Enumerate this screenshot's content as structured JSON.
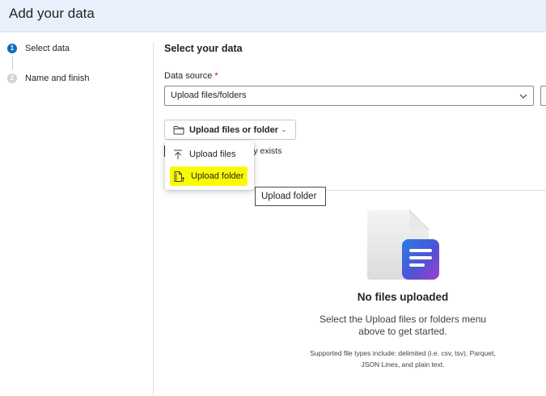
{
  "header": {
    "title": "Add your data"
  },
  "stepper": {
    "steps": [
      {
        "number": "1",
        "label": "Select data",
        "state": "active"
      },
      {
        "number": "2",
        "label": "Name and finish",
        "state": "inactive"
      }
    ]
  },
  "main": {
    "section_title": "Select your data",
    "data_source": {
      "label": "Data source",
      "required_mark": "*",
      "value": "Upload files/folders"
    },
    "upload_button": {
      "label": "Upload files or folder",
      "icon": "folder-icon"
    },
    "partial_text": "ly exists",
    "menu": {
      "items": [
        {
          "label": "Upload files",
          "icon": "upload-arrow-icon",
          "highlighted": false
        },
        {
          "label": "Upload folder",
          "icon": "folder-upload-icon",
          "highlighted": true
        }
      ]
    },
    "tooltip": "Upload folder",
    "empty_state": {
      "title": "No files uploaded",
      "description": "Select the Upload files or folders menu above to get started.",
      "note": "Supported file types include: delimited (i.e. csv, tsv), Parquet, JSON Lines, and plain text."
    }
  },
  "colors": {
    "header_bg": "#e8f1fb",
    "accent": "#0f6cbd",
    "highlight": "#fcf905",
    "required": "#c50f1f"
  }
}
